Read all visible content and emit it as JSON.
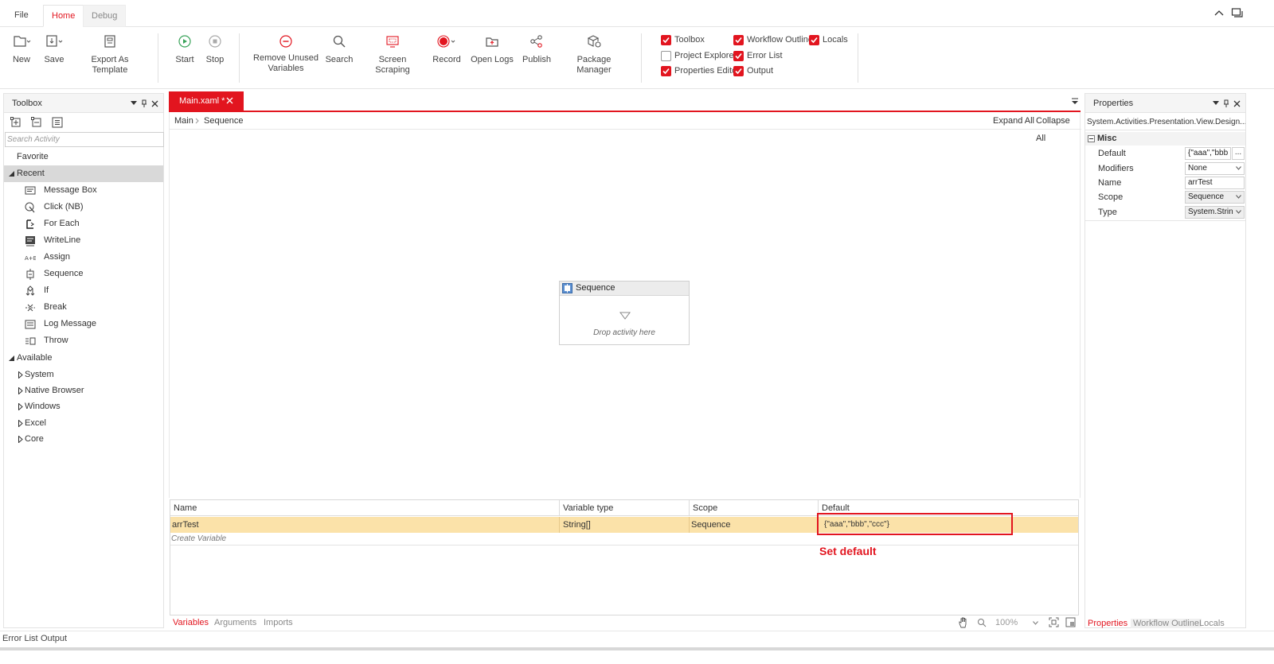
{
  "ribbon_tabs": [
    "File",
    "Home",
    "Debug"
  ],
  "ribbon": {
    "new": "New",
    "save": "Save",
    "export_template": "Export As Template",
    "start": "Start",
    "stop": "Stop",
    "remove_unused_1": "Remove Unused",
    "remove_unused_2": "Variables",
    "search": "Search",
    "screen_scraping": "Screen Scraping",
    "record": "Record",
    "open_logs": "Open Logs",
    "publish": "Publish",
    "package_manager": "Package Manager"
  },
  "panels_checks": [
    {
      "label": "Toolbox",
      "checked": true
    },
    {
      "label": "Workflow Outline",
      "checked": true
    },
    {
      "label": "Locals",
      "checked": true
    },
    {
      "label": "Project Explorer",
      "checked": false
    },
    {
      "label": "Error List",
      "checked": true
    },
    {
      "label": "Properties Editor",
      "checked": true
    },
    {
      "label": "Output",
      "checked": true
    }
  ],
  "toolbox": {
    "title": "Toolbox",
    "search_placeholder": "Search Activity",
    "favorite": "Favorite",
    "recent": "Recent",
    "recent_items": [
      "Message Box",
      "Click (NB)",
      "For Each",
      "WriteLine",
      "Assign",
      "Sequence",
      "If",
      "Break",
      "Log Message",
      "Throw"
    ],
    "available": "Available",
    "available_items": [
      "System",
      "Native Browser",
      "Windows",
      "Excel",
      "Core"
    ]
  },
  "document": {
    "tab": "Main.xaml *",
    "crumb_main": "Main",
    "crumb_sequence": "Sequence",
    "expand_all": "Expand All",
    "collapse_all": "Collapse All",
    "sequence_title": "Sequence",
    "drop_hint": "Drop activity here"
  },
  "variables": {
    "headers": [
      "Name",
      "Variable type",
      "Scope",
      "Default"
    ],
    "row": {
      "name": "arrTest",
      "type": "String[]",
      "scope": "Sequence",
      "default": "{\"aaa\",\"bbb\",\"ccc\"}"
    },
    "create": "Create Variable",
    "annotation": "Set default"
  },
  "bottom_tabs": [
    "Variables",
    "Arguments",
    "Imports"
  ],
  "zoom": "100%",
  "status_tabs": [
    "Error List",
    "Output"
  ],
  "properties": {
    "title": "Properties",
    "type_name": "System.Activities.Presentation.View.Design...",
    "section": "Misc",
    "rows": [
      {
        "label": "Default",
        "value": "{\"aaa\",\"bbb"
      },
      {
        "label": "Modifiers",
        "value": "None"
      },
      {
        "label": "Name",
        "value": "arrTest"
      },
      {
        "label": "Scope",
        "value": "Sequence"
      },
      {
        "label": "Type",
        "value": "System.Strin"
      }
    ],
    "tabs": [
      "Properties",
      "Workflow Outline",
      "Locals"
    ]
  },
  "colors": {
    "accent": "#e2151f",
    "highlight": "#fbe2a9",
    "annotation": "#e2151f"
  }
}
